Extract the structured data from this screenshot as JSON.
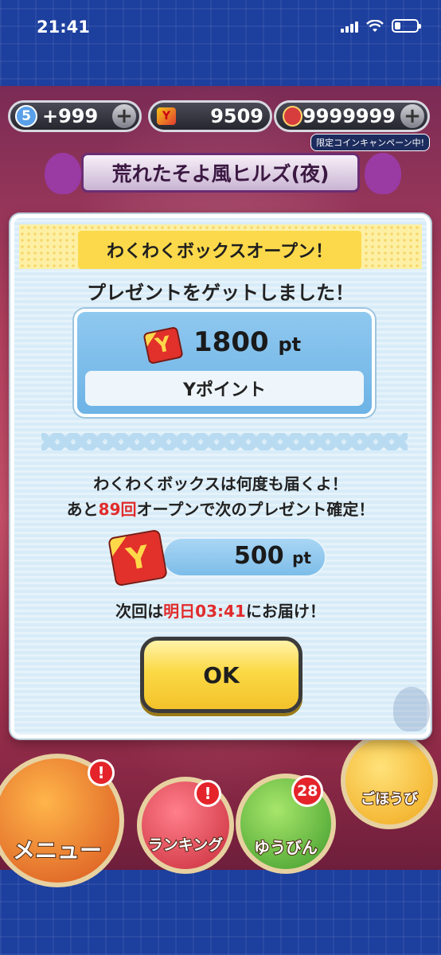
{
  "status_bar": {
    "time": "21:41",
    "battery_level": 0.25
  },
  "hud": {
    "life_level": "5",
    "life_value": "+999",
    "plus_symbol": "+",
    "points_icon_letter": "Y",
    "points_value": "9509",
    "coins_value": "9999999",
    "campaign_label": "限定コインキャンペーン中!"
  },
  "area": {
    "title": "荒れたそよ風ヒルズ(夜)"
  },
  "dialog": {
    "title": "わくわくボックスオープン！",
    "subtitle": "プレゼントをゲットしました！",
    "prize": {
      "card_letter": "Y",
      "amount": "1800",
      "unit": "pt",
      "name": "Yポイント"
    },
    "message_line1": "わくわくボックスは何度も届くよ！",
    "message_line2": {
      "prefix": "あと",
      "count": "89回",
      "suffix": "オープンで次のプレゼント確定！"
    },
    "next_prize": {
      "card_letter": "Y",
      "amount": "500",
      "unit": "pt"
    },
    "next_delivery": {
      "prefix": "次回は",
      "time": "明日03:41",
      "suffix": "にお届け！"
    },
    "ok_label": "OK"
  },
  "bottom_menu": {
    "menu_label": "メニュー",
    "ranking_label": "ランキング",
    "mail_label": "ゆうびん",
    "mail_count": "28",
    "reward_label": "ごほうび",
    "alert_symbol": "!"
  }
}
